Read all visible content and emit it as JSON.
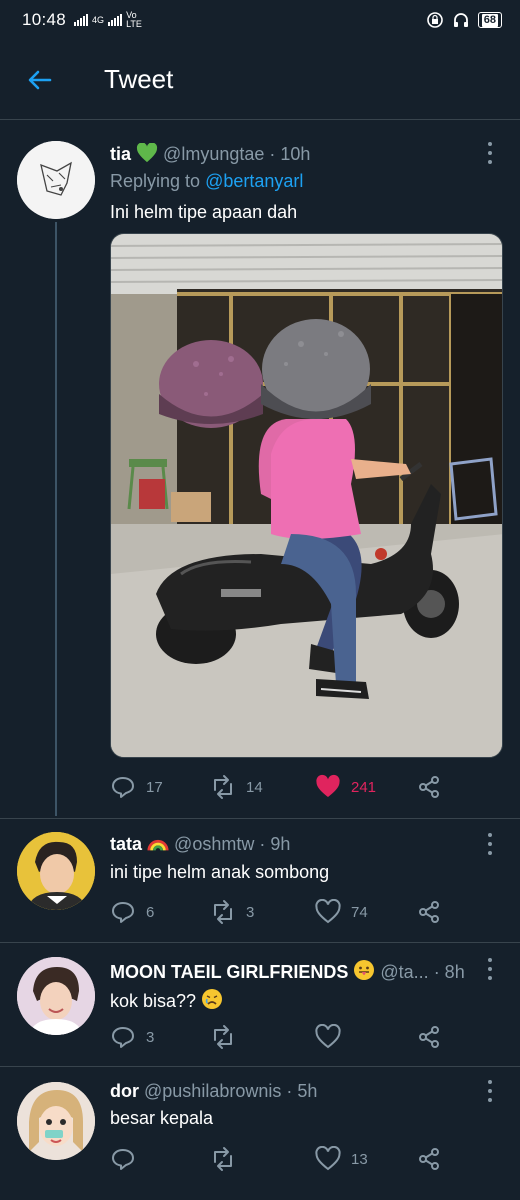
{
  "status_bar": {
    "time": "10:48",
    "network": "4G",
    "volte": "Vo LTE",
    "battery": "68"
  },
  "header": {
    "title": "Tweet"
  },
  "main_tweet": {
    "name": "tia",
    "name_emoji": "green-heart",
    "handle": "@lmyungtae",
    "time": "· 10h",
    "replying_prefix": "Replying to",
    "replying_to": "@bertanyarl",
    "text": "Ini helm tipe apaan dah",
    "media_alt": "two people in pink shirts with giant helmets on a scooter",
    "replies": "17",
    "retweets": "14",
    "likes": "241",
    "liked": true
  },
  "replies": [
    {
      "name": "tata",
      "name_emoji": "rainbow",
      "handle": "@oshmtw",
      "time": "· 9h",
      "text": "ini tipe helm anak sombong",
      "replies": "6",
      "retweets": "3",
      "likes": "74"
    },
    {
      "name": "MOON TAEIL GIRLFRIENDS",
      "name_emoji": "tongue-face",
      "handle": "@ta...",
      "time": "· 8h",
      "text": "kok bisa??",
      "text_emoji": "sad-face",
      "replies": "3",
      "retweets": "",
      "likes": ""
    },
    {
      "name": "dor",
      "name_emoji": "",
      "handle": "@pushilabrownis",
      "time": "· 5h",
      "text": "besar kepala",
      "replies": "",
      "retweets": "",
      "likes": "13"
    }
  ],
  "colors": {
    "background": "#15202b",
    "secondary_text": "#8899a6",
    "accent": "#1da1f2",
    "like": "#e0245e",
    "divider": "#38444d"
  }
}
